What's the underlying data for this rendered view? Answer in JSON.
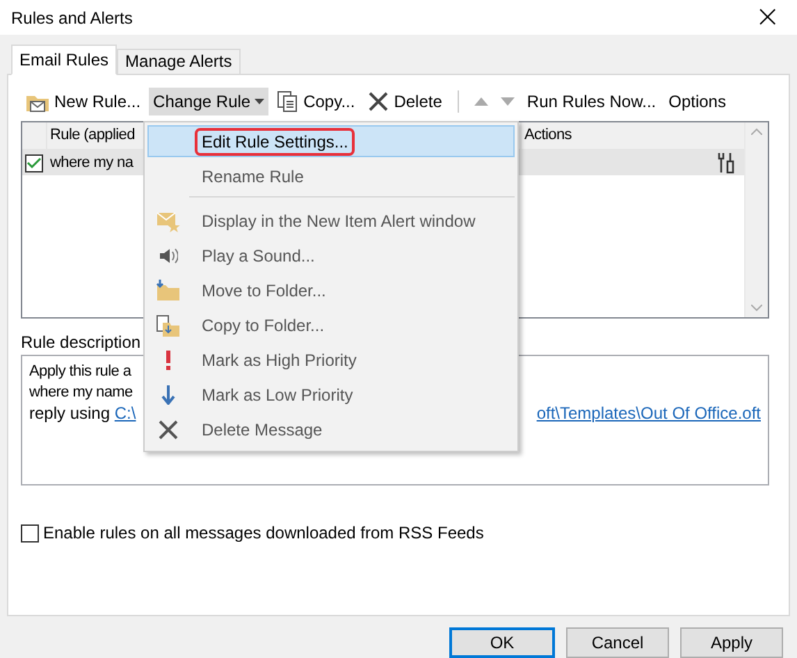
{
  "window": {
    "title": "Rules and Alerts",
    "close": "×"
  },
  "tabs": [
    {
      "label": "Email Rules",
      "selected": true
    },
    {
      "label": "Manage Alerts",
      "selected": false
    }
  ],
  "toolbar": [
    {
      "kind": "new",
      "label": "New Rule...",
      "pressed": false,
      "disabled": false
    },
    {
      "kind": "dropdown",
      "label": "Change Rule",
      "pressed": true,
      "disabled": false
    },
    {
      "kind": "copy",
      "label": "Copy...",
      "pressed": false,
      "disabled": false
    },
    {
      "kind": "delete",
      "label": "Delete",
      "pressed": false,
      "disabled": false
    },
    {
      "kind": "separator"
    },
    {
      "kind": "up",
      "pressed": false,
      "disabled": true
    },
    {
      "kind": "down",
      "pressed": false,
      "disabled": true
    },
    {
      "kind": "text",
      "label": "Run Rules Now...",
      "pressed": false,
      "disabled": false
    },
    {
      "kind": "text",
      "label": "Options",
      "pressed": false,
      "disabled": false
    }
  ],
  "rules_table": {
    "columns": [
      "Rule (applied",
      "Actions"
    ],
    "rows": [
      {
        "name": "where my na",
        "checked": true,
        "selected": true
      }
    ]
  },
  "menu": [
    {
      "kind": "plain",
      "label": "Edit Rule Settings...",
      "selected": true,
      "disabled": false,
      "outlined": true
    },
    {
      "kind": "plain",
      "label": "Rename Rule",
      "selected": false,
      "disabled": true,
      "outlined": false
    },
    {
      "kind": "separator"
    },
    {
      "kind": "alert",
      "label": "Display in the New Item Alert window",
      "selected": false,
      "disabled": true,
      "outlined": false
    },
    {
      "kind": "sound",
      "label": "Play a Sound...",
      "selected": false,
      "disabled": true,
      "outlined": false
    },
    {
      "kind": "move",
      "label": "Move to Folder...",
      "selected": false,
      "disabled": true,
      "outlined": false
    },
    {
      "kind": "copy",
      "label": "Copy to Folder...",
      "selected": false,
      "disabled": true,
      "outlined": false
    },
    {
      "kind": "high",
      "label": "Mark as High Priority",
      "selected": false,
      "disabled": true,
      "outlined": false
    },
    {
      "kind": "low",
      "label": "Mark as Low Priority",
      "selected": false,
      "disabled": true,
      "outlined": false
    },
    {
      "kind": "delete",
      "label": "Delete Message",
      "selected": false,
      "disabled": true,
      "outlined": false
    }
  ],
  "description": {
    "label": "Rule description",
    "lines": [
      "Apply this rule a",
      "where my name"
    ],
    "reply_prefix": "reply using ",
    "link_start": "C:\\",
    "link_end": "oft\\Templates\\Out Of Office.oft"
  },
  "rss_option": {
    "label": "Enable rules on all messages downloaded from RSS Feeds",
    "checked": false
  },
  "buttons": [
    {
      "label": "OK",
      "default": true
    },
    {
      "label": "Cancel",
      "default": false
    },
    {
      "label": "Apply",
      "default": false
    }
  ]
}
